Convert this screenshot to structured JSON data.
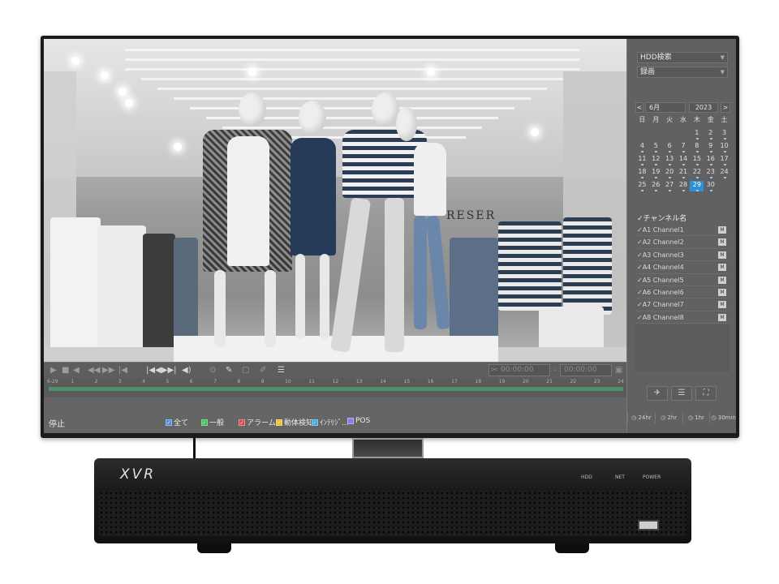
{
  "panel": {
    "search_type": "HDD検索",
    "record_type": "録画",
    "calendar": {
      "month": "6月",
      "year": "2023",
      "prev_label": "<",
      "next_label": ">",
      "weekdays": [
        "日",
        "月",
        "火",
        "水",
        "木",
        "金",
        "土"
      ],
      "days": [
        "",
        "",
        "",
        "",
        "1",
        "2",
        "3",
        "4",
        "5",
        "6",
        "7",
        "8",
        "9",
        "10",
        "11",
        "12",
        "13",
        "14",
        "15",
        "16",
        "17",
        "18",
        "19",
        "20",
        "21",
        "22",
        "23",
        "24",
        "25",
        "26",
        "27",
        "28",
        "29",
        "30"
      ],
      "selected_day": "29"
    },
    "channel_header": "✓チャンネル名",
    "channels": [
      {
        "label": "✓A1 Channel1",
        "badge": "M"
      },
      {
        "label": "✓A2 Channel2",
        "badge": "M"
      },
      {
        "label": "✓A3 Channel3",
        "badge": "M"
      },
      {
        "label": "✓A4 Channel4",
        "badge": "M"
      },
      {
        "label": "✓A5 Channel5",
        "badge": "M"
      },
      {
        "label": "✓A6 Channel6",
        "badge": "M"
      },
      {
        "label": "✓A7 Channel7",
        "badge": "M"
      },
      {
        "label": "✓A8 Channel8",
        "badge": "M"
      }
    ],
    "time_scales": [
      "24hr",
      "2hr",
      "1hr",
      "30min"
    ]
  },
  "playback": {
    "status": "停止",
    "start_time": "00:00:00",
    "end_time": "00:00:00",
    "time_separator": "-",
    "timeline_ticks": [
      "6-29",
      "1",
      "2",
      "3",
      "4",
      "5",
      "6",
      "7",
      "8",
      "9",
      "10",
      "11",
      "12",
      "13",
      "14",
      "15",
      "16",
      "17",
      "18",
      "19",
      "20",
      "21",
      "22",
      "23",
      "24"
    ]
  },
  "legend": [
    {
      "label": "全て",
      "color": "#4a90d9",
      "check": "✓"
    },
    {
      "label": "一般",
      "color": "#3fbf5a",
      "check": "✓"
    },
    {
      "label": "アラーム",
      "color": "#d94a4a",
      "check": "✓"
    },
    {
      "label": "動体検知",
      "color": "#e6c229",
      "check": "✓"
    },
    {
      "label": "ｲﾝﾃﾘｼﾞ...",
      "color": "#3fa6e0",
      "check": "✓"
    },
    {
      "label": "POS",
      "color": "#8c7ae6",
      "check": ""
    }
  ],
  "scene": {
    "store_sign": "RESER"
  },
  "device": {
    "logo": "XVR",
    "led_hdd": "HDD",
    "led_net": "NET",
    "led_power": "POWER"
  }
}
